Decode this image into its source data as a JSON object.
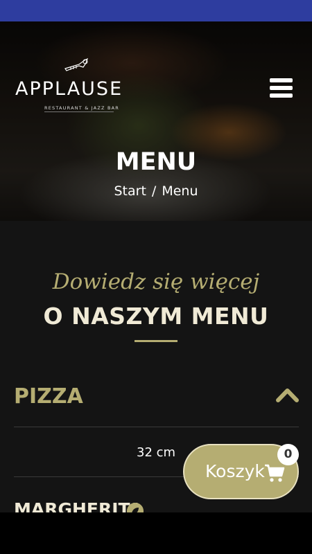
{
  "header": {
    "brand_name": "APPLAUSE",
    "brand_tagline": "RESTAURANT & JAZZ BAR",
    "menu_icon": "hamburger-menu-icon"
  },
  "hero": {
    "title": "MENU",
    "breadcrumb": {
      "start": "Start",
      "separator": "/",
      "current": "Menu"
    }
  },
  "intro": {
    "script_title": "Dowiedz się więcej",
    "title": "O NASZYM MENU"
  },
  "menu": {
    "category": "PIZZA",
    "category_icon": "chevron-up-icon",
    "size_label": "32 cm",
    "first_item": "MARGHERITA",
    "item_icon": "veggie-leaf-icon"
  },
  "cart": {
    "label": "Koszyk",
    "count": "0",
    "icon": "shopping-cart-icon"
  },
  "colors": {
    "status_bar": "#2e3d9f",
    "accent_gold": "#b5ad72",
    "cream_text": "#f0ead6",
    "background": "#141414"
  }
}
